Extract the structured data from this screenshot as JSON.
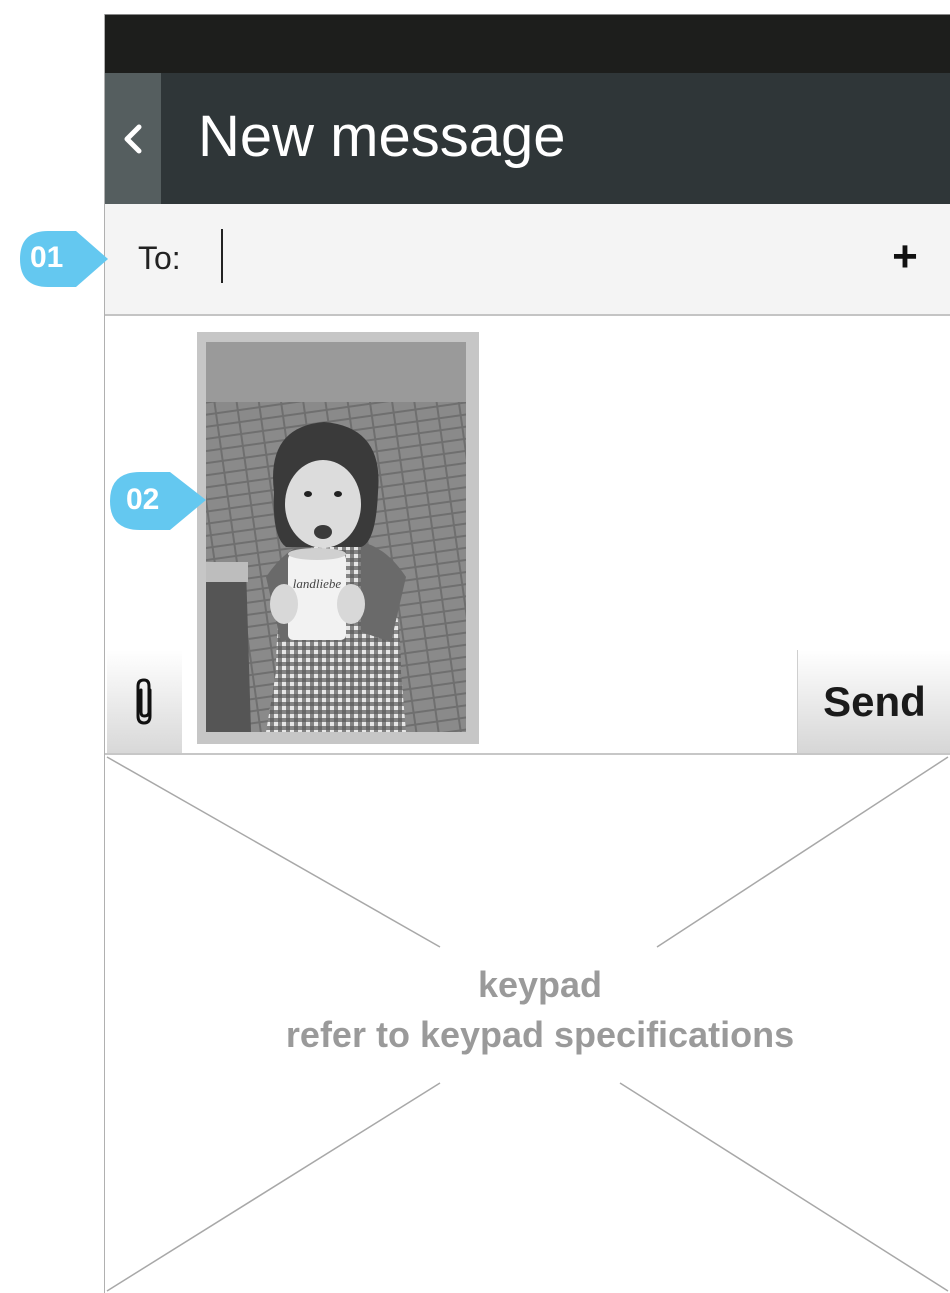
{
  "app_bar": {
    "title": "New message",
    "back_glyph": "‹"
  },
  "recipient": {
    "label": "To:",
    "value": "",
    "add_glyph": "+"
  },
  "compose": {
    "attachment": {
      "type": "photo",
      "icon": "paperclip-icon"
    },
    "send_label": "Send"
  },
  "keypad": {
    "line1": "keypad",
    "line2": "refer to keypad specifications"
  },
  "callouts": [
    "01",
    "02"
  ],
  "colors": {
    "status_bar": "#1d1e1c",
    "app_bar": "#2f3638",
    "back_button": "#555e5f",
    "callout": "#64c8f0",
    "keypad_text": "#9a9a9a"
  }
}
